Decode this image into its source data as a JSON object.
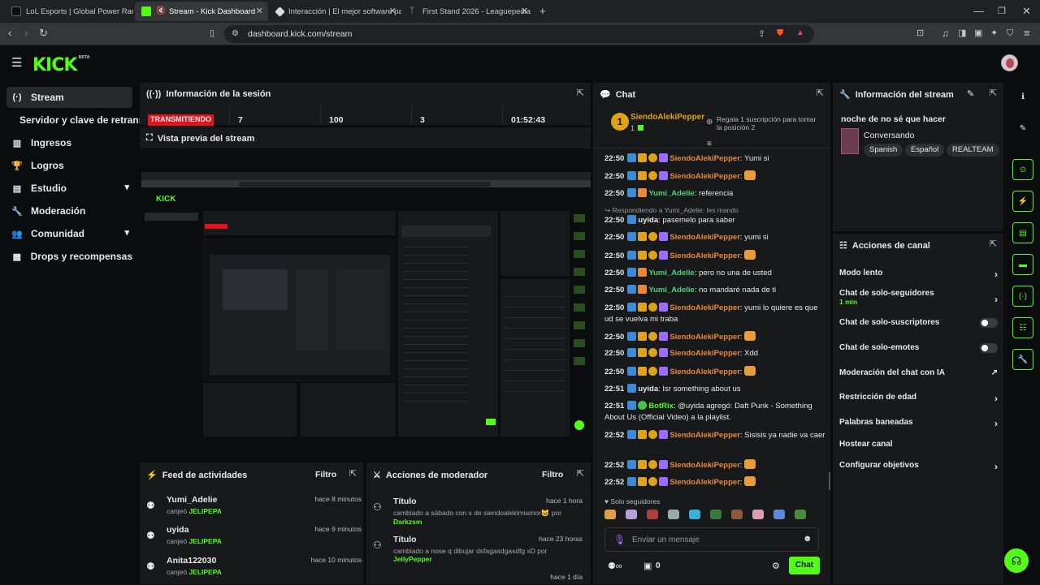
{
  "browser": {
    "tabs": [
      {
        "title": "LoL Esports | Global Power Rankings",
        "active": false
      },
      {
        "title": "Stream - Kick Dashboard",
        "active": true
      },
      {
        "title": "Interacción | El mejor software pa",
        "active": false
      },
      {
        "title": "First Stand 2026 - Leaguepedia |",
        "active": false
      }
    ],
    "url": "dashboard.kick.com/stream"
  },
  "app": {
    "logo": "KICK",
    "logo_badge": "BETA"
  },
  "sidebar": {
    "items": [
      {
        "label": "Stream",
        "icon": "broadcast-icon"
      },
      {
        "label": "Servidor y clave de retransm",
        "icon": ""
      },
      {
        "label": "Ingresos",
        "icon": "chart-icon"
      },
      {
        "label": "Logros",
        "icon": "trophy-icon"
      },
      {
        "label": "Estudio",
        "icon": "studio-icon"
      },
      {
        "label": "Moderación",
        "icon": "wrench-icon"
      },
      {
        "label": "Comunidad",
        "icon": "people-icon"
      },
      {
        "label": "Drops y recompensas",
        "icon": "gift-icon"
      }
    ]
  },
  "session": {
    "title": "Información de la sesión",
    "live_badge": "TRANSMITIENDO",
    "stats": [
      "7",
      "100",
      "3",
      "01:52:43"
    ]
  },
  "preview": {
    "title": "Vista previa del stream"
  },
  "activity": {
    "title": "Feed de actividades",
    "filter": "Filtro",
    "items": [
      {
        "name": "Yumi_Adelie",
        "time": "hace 8 minutos",
        "action": "canjeó",
        "reward": "JELIPEPA"
      },
      {
        "name": "uyida",
        "time": "hace 9 minutos",
        "action": "canjeó",
        "reward": "JELIPEPA"
      },
      {
        "name": "Anita122030",
        "time": "hace 10 minutos",
        "action": "canjeó",
        "reward": "JELIPEPA"
      }
    ]
  },
  "modactions": {
    "title": "Acciones de moderador",
    "filter": "Filtro",
    "items": [
      {
        "name": "Título",
        "time": "hace 1 hora",
        "line1": "cambiado a sábado con s de siendoalekimiamor😺 por",
        "by": "Darkzsm"
      },
      {
        "name": "Título",
        "time": "hace 23 horas",
        "line1": "cambiado a nose q dibujar dsfagasdgasdfg xD por",
        "by": "JellyPepper"
      },
      {
        "name": "",
        "time": "hace 1 día",
        "line1": "",
        "by": ""
      }
    ]
  },
  "chat": {
    "title": "Chat",
    "top_user": "SiendoAlekiPepper",
    "top_count": "1",
    "top_note": "Regala 1 suscripción para tomar la posición 2",
    "reply_note": "Respondiendo a Yumi_Adelie: les mando",
    "followers_only": "Solo seguidores",
    "input_placeholder": "Enviar un mensaje",
    "send": "Chat",
    "viewer_count": "0",
    "messages": [
      {
        "time": "22:50",
        "user": "SiendoAlekiPepper",
        "color": "#e8893a",
        "text": ": Yumi si"
      },
      {
        "time": "22:50",
        "user": "SiendoAlekiPepper",
        "color": "#e8893a",
        "text": ":"
      },
      {
        "time": "22:50",
        "user": "Yumi_Adelie",
        "color": "#4fd27a",
        "text": ": referencia"
      },
      {
        "time": "22:50",
        "user": "uyida",
        "color": "#e8e8e8",
        "text": ": pasemelo para saber"
      },
      {
        "time": "22:50",
        "user": "SiendoAlekiPepper",
        "color": "#e8893a",
        "text": ": yumi si"
      },
      {
        "time": "22:50",
        "user": "SiendoAlekiPepper",
        "color": "#e8893a",
        "text": ":"
      },
      {
        "time": "22:50",
        "user": "Yumi_Adelie",
        "color": "#4fd27a",
        "text": ": pero no una de usted"
      },
      {
        "time": "22:50",
        "user": "Yumi_Adelie",
        "color": "#4fd27a",
        "text": ": no mandaré nada de ti"
      },
      {
        "time": "22:50",
        "user": "SiendoAlekiPepper",
        "color": "#e8893a",
        "text": ": yumi lo quiere es que ud se vuelva mi traba"
      },
      {
        "time": "22:50",
        "user": "SiendoAlekiPepper",
        "color": "#e8893a",
        "text": ":"
      },
      {
        "time": "22:50",
        "user": "SiendoAlekiPepper",
        "color": "#e8893a",
        "text": ": Xdd"
      },
      {
        "time": "22:50",
        "user": "SiendoAlekiPepper",
        "color": "#e8893a",
        "text": ":"
      },
      {
        "time": "22:51",
        "user": "uyida",
        "color": "#e8e8e8",
        "text": ": Isr something about us"
      },
      {
        "time": "22:51",
        "user": "BotRix",
        "color": "#53fc18",
        "text": ": @uyida agregó: Daft Punk - Something About Us (Official Video) a la playlist."
      },
      {
        "time": "22:52",
        "user": "SiendoAlekiPepper",
        "color": "#e8893a",
        "text": ": Sisisis ya nadie va caer"
      },
      {
        "time": "22:52",
        "user": "SiendoAlekiPepper",
        "color": "#e8893a",
        "text": ":"
      },
      {
        "time": "22:52",
        "user": "SiendoAlekiPepper",
        "color": "#e8893a",
        "text": ":"
      }
    ]
  },
  "stream_info": {
    "title": "Información del stream",
    "stream_title": "noche de no sé que hacer",
    "category": "Conversando",
    "tags": [
      "Spanish",
      "Español",
      "REALTEAM"
    ]
  },
  "channel_actions": {
    "title": "Acciones de canal",
    "items": [
      {
        "label": "Modo lento",
        "sub": "",
        "control": "chevron"
      },
      {
        "label": "Chat de solo-seguidores",
        "sub": "1 min",
        "control": "chevron"
      },
      {
        "label": "Chat de solo-suscriptores",
        "sub": "",
        "control": "toggle"
      },
      {
        "label": "Chat de solo-emotes",
        "sub": "",
        "control": "toggle"
      },
      {
        "label": "Moderación del chat con IA",
        "sub": "",
        "control": "external"
      },
      {
        "label": "Restricción de edad",
        "sub": "",
        "control": "chevron"
      },
      {
        "label": "Palabras baneadas",
        "sub": "",
        "control": "chevron"
      },
      {
        "label": "Hostear canal",
        "sub": "",
        "control": "none"
      },
      {
        "label": "Configurar objetivos",
        "sub": "",
        "control": "chevron"
      }
    ]
  },
  "colors": {
    "brand": "#53fc18",
    "live": "#e0131f",
    "panel": "#17191b",
    "bg": "#0b0c0d"
  }
}
